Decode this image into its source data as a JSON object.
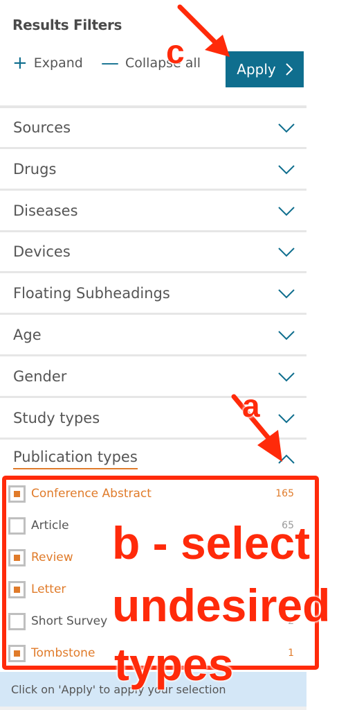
{
  "panel": {
    "title": "Results Filters",
    "expand_label": "Expand",
    "collapse_label": "Collapse all",
    "apply_label": "Apply",
    "apply_icon": "chevron-right-icon"
  },
  "facets": [
    {
      "label": "Sources",
      "state": "collapsed"
    },
    {
      "label": "Drugs",
      "state": "collapsed"
    },
    {
      "label": "Diseases",
      "state": "collapsed"
    },
    {
      "label": "Devices",
      "state": "collapsed"
    },
    {
      "label": "Floating Subheadings",
      "state": "collapsed"
    },
    {
      "label": "Age",
      "state": "collapsed"
    },
    {
      "label": "Gender",
      "state": "collapsed"
    },
    {
      "label": "Study types",
      "state": "collapsed"
    },
    {
      "label": "Publication types",
      "state": "expanded"
    }
  ],
  "publication_types": [
    {
      "label": "Conference Abstract",
      "count": "165",
      "checked": true
    },
    {
      "label": "Article",
      "count": "65",
      "checked": false
    },
    {
      "label": "Review",
      "count": "",
      "checked": true
    },
    {
      "label": "Letter",
      "count": "",
      "checked": true
    },
    {
      "label": "Short Survey",
      "count": "2",
      "checked": false
    },
    {
      "label": "Tombstone",
      "count": "1",
      "checked": true
    }
  ],
  "hint": "Click on 'Apply' to apply your selection",
  "annotations": {
    "a": "a",
    "b_line1": "b - select",
    "b_line2": "undesired",
    "b_line3": "types",
    "c": "c",
    "color": "#ff2a0a"
  },
  "colors": {
    "accent": "#0f6e8e",
    "selected": "#e07b2a",
    "hint_bg": "#d4e7f7"
  }
}
